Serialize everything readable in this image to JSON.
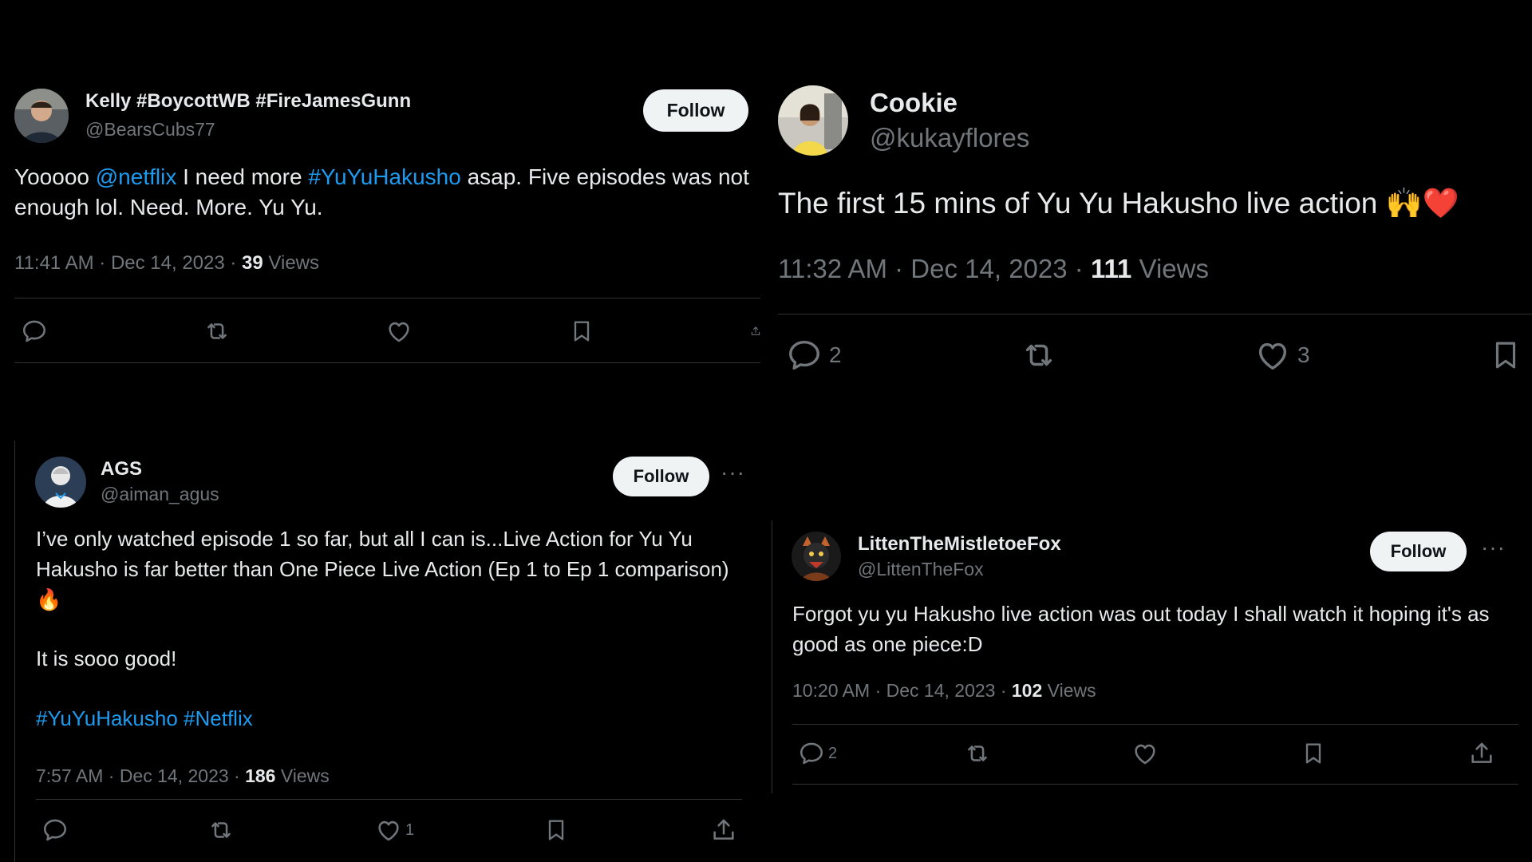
{
  "colors": {
    "background": "#000000",
    "text": "#e7e9ea",
    "muted": "#71767b",
    "link": "#1d9bf0",
    "divider": "#2f3336",
    "follow_bg": "#eff3f4"
  },
  "tweets": [
    {
      "display_name": "Kelly #BoycottWB #FireJamesGunn",
      "handle": "@BearsCubs77",
      "follow_label": "Follow",
      "text_parts": [
        "Yooooo ",
        "@netflix",
        " I need more ",
        "#YuYuHakusho",
        " asap. Five episodes was not enough lol. Need. More. Yu Yu."
      ],
      "time": "11:41 AM · Dec 14, 2023 · ",
      "views_count": "39",
      "views_label": " Views",
      "icons": [
        "reply-icon",
        "retweet-icon",
        "like-icon",
        "bookmark-icon",
        "share-icon"
      ]
    },
    {
      "display_name": "Cookie",
      "handle": "@kukayflores",
      "text": "The first 15 mins of Yu Yu Hakusho live  action 🙌❤️",
      "time": "11:32 AM · Dec 14, 2023 · ",
      "views_count": "111",
      "views_label": " Views",
      "reply_count": "2",
      "like_count": "3",
      "icons": [
        "reply-icon",
        "retweet-icon",
        "like-icon",
        "bookmark-icon"
      ]
    },
    {
      "display_name": "AGS",
      "handle": "@aiman_agus",
      "follow_label": "Follow",
      "more_label": "···",
      "text_line1": "I’ve only watched episode 1 so far, but all I can is...Live Action for Yu Yu Hakusho is far better than One Piece Live Action (Ep 1 to Ep 1 comparison)🔥",
      "text_line2": "It is sooo good!",
      "hashtags": "#YuYuHakusho #Netflix",
      "time": "7:57 AM · Dec 14, 2023 · ",
      "views_count": "186",
      "views_label": " Views",
      "like_count": "1",
      "icons": [
        "reply-icon",
        "retweet-icon",
        "like-icon",
        "bookmark-icon",
        "share-icon"
      ]
    },
    {
      "display_name": "LittenTheMistletoeFox",
      "handle": "@LittenTheFox",
      "follow_label": "Follow",
      "more_label": "···",
      "text": "Forgot yu yu Hakusho live action was out today I shall watch it hoping it's as good as one piece:D",
      "time": "10:20 AM · Dec 14, 2023 · ",
      "views_count": "102",
      "views_label": " Views",
      "reply_count": "2",
      "icons": [
        "reply-icon",
        "retweet-icon",
        "like-icon",
        "bookmark-icon",
        "share-icon"
      ]
    }
  ]
}
